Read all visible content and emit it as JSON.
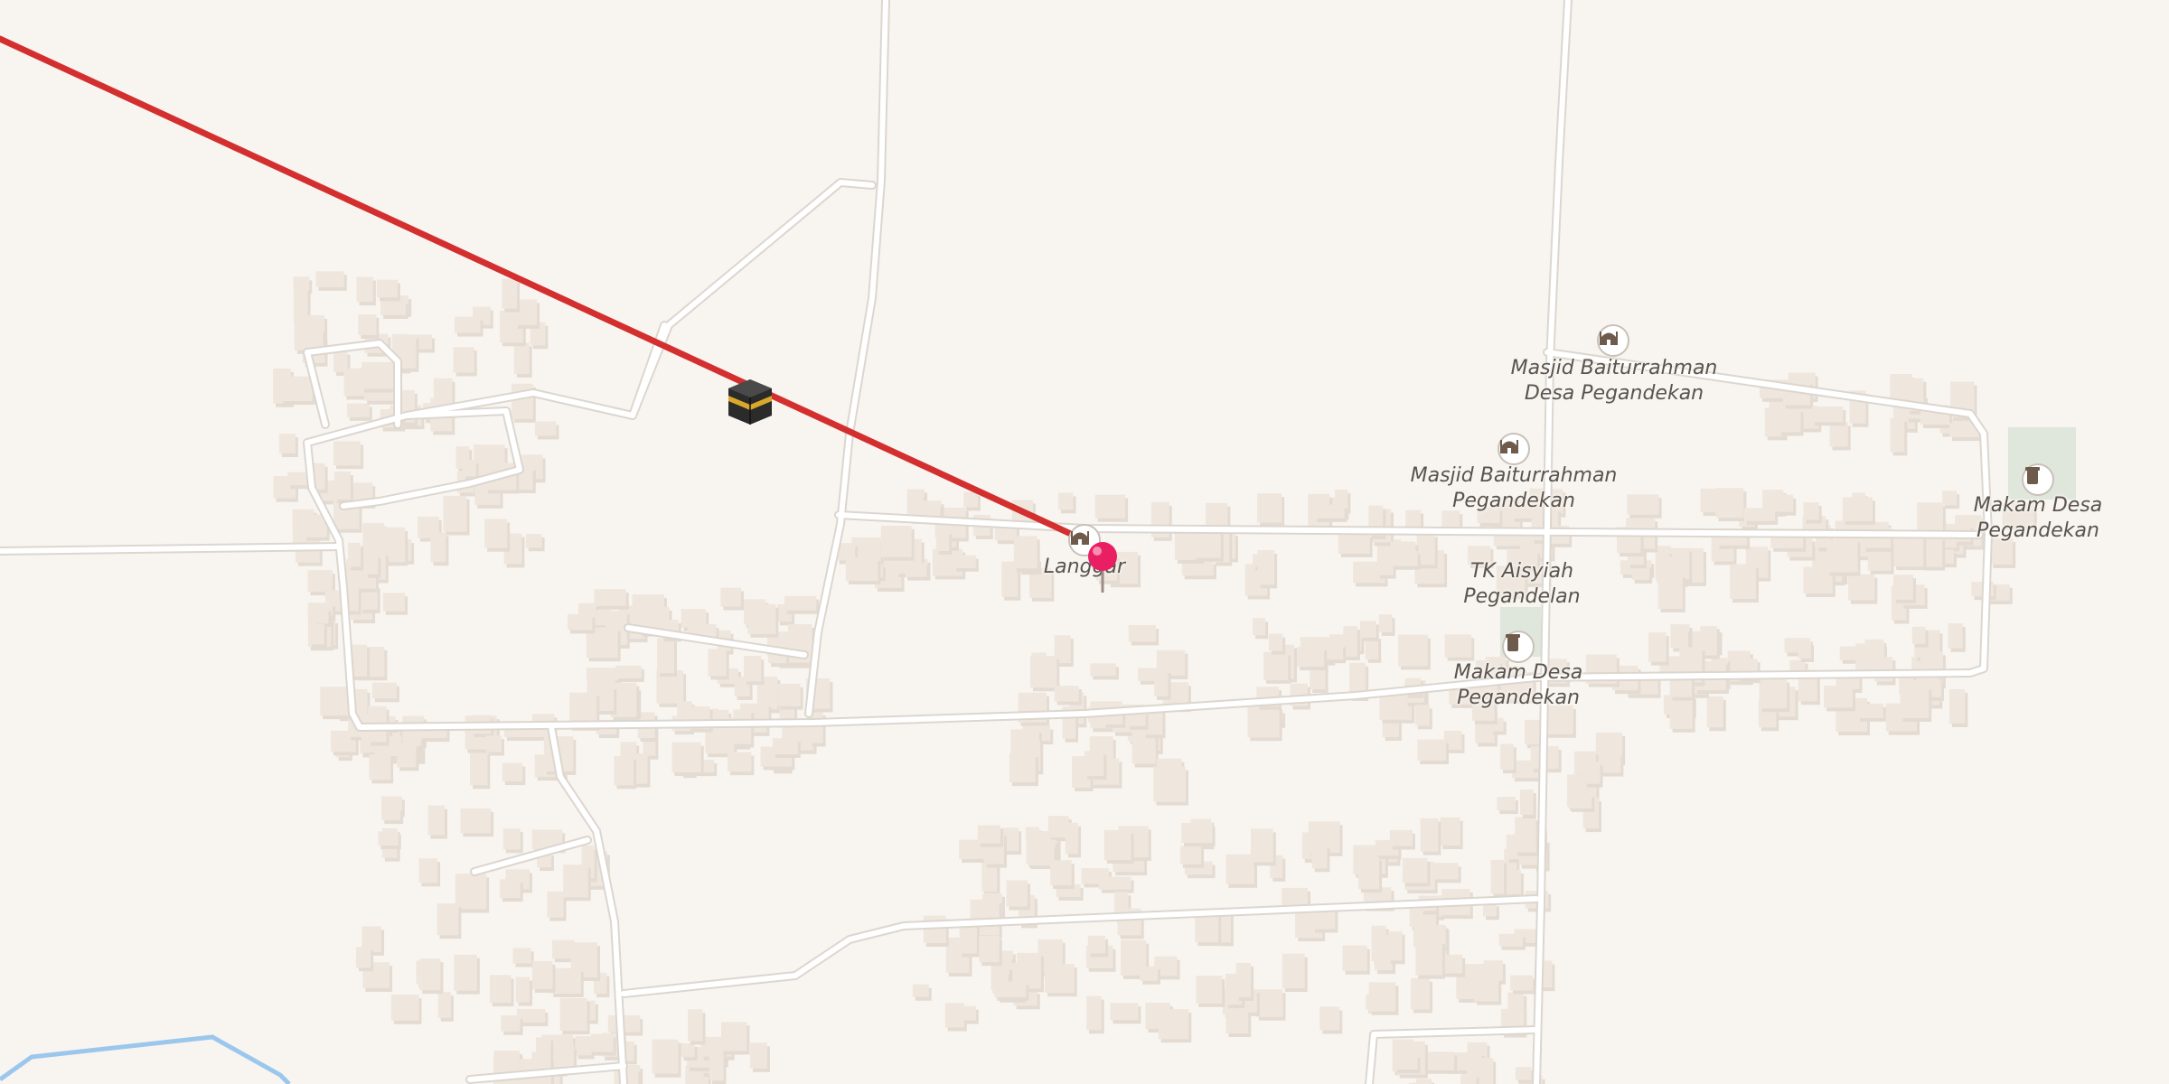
{
  "map": {
    "pois": [
      {
        "id": "langgar",
        "label_lines": [
          "Langgar"
        ],
        "kind": "mosque"
      },
      {
        "id": "masjid-desa",
        "label_lines": [
          "Masjid Baiturrahman",
          "Desa Pegandekan"
        ],
        "kind": "mosque"
      },
      {
        "id": "masjid-peg",
        "label_lines": [
          "Masjid Baiturrahman",
          "Pegandekan"
        ],
        "kind": "mosque"
      },
      {
        "id": "tk-aisyiah",
        "label_lines": [
          "TK Aisyiah",
          "Pegandelan"
        ],
        "kind": "school"
      },
      {
        "id": "makam-1",
        "label_lines": [
          "Makam Desa",
          "Pegandekan"
        ],
        "kind": "cemetery"
      },
      {
        "id": "makam-2",
        "label_lines": [
          "Makam Desa",
          "Pegandekan"
        ],
        "kind": "cemetery"
      }
    ],
    "colors": {
      "background": "#f8f5f1",
      "road": "#ffffff",
      "road_casing": "#dcd6cf",
      "building": "#efe7de",
      "qibla_line": "#d32f2f",
      "pin": "#e91e63",
      "water": "#9cc7ec",
      "cemetery": "#dfe6dc"
    },
    "markers": {
      "location_pin": "location-pin-icon",
      "kaaba": "kaaba-icon"
    }
  }
}
